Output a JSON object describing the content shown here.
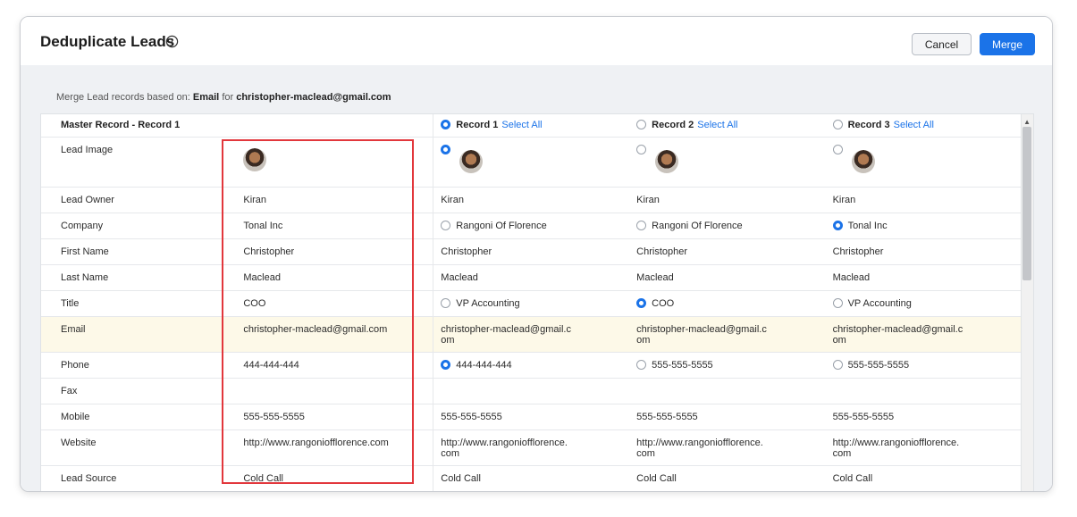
{
  "header": {
    "title": "Deduplicate Leads",
    "cancel_label": "Cancel",
    "merge_label": "Merge"
  },
  "merge_info": {
    "prefix": "Merge Lead records based on:",
    "field": "Email",
    "mid": "for",
    "value": "christopher-maclead@gmail.com"
  },
  "columns": {
    "master": "Master Record - Record 1",
    "records": [
      {
        "label": "Record 1",
        "select_all": "Select All",
        "selected": true
      },
      {
        "label": "Record 2",
        "select_all": "Select All",
        "selected": false
      },
      {
        "label": "Record 3",
        "select_all": "Select All",
        "selected": false
      }
    ]
  },
  "rows": [
    {
      "field": "Lead Image",
      "master": "",
      "values": [
        "",
        "",
        ""
      ],
      "radios": [
        true,
        false,
        false
      ],
      "image": true
    },
    {
      "field": "Lead Owner",
      "master": "Kiran",
      "values": [
        "Kiran",
        "Kiran",
        "Kiran"
      ]
    },
    {
      "field": "Company",
      "master": "Tonal Inc",
      "values": [
        "Rangoni Of Florence",
        "Rangoni Of Florence",
        "Tonal Inc"
      ],
      "radios": [
        false,
        false,
        true
      ]
    },
    {
      "field": "First Name",
      "master": "Christopher",
      "values": [
        "Christopher",
        "Christopher",
        "Christopher"
      ]
    },
    {
      "field": "Last Name",
      "master": "Maclead",
      "values": [
        "Maclead",
        "Maclead",
        "Maclead"
      ]
    },
    {
      "field": "Title",
      "master": "COO",
      "values": [
        "VP Accounting",
        "COO",
        "VP Accounting"
      ],
      "radios": [
        false,
        true,
        false
      ]
    },
    {
      "field": "Email",
      "master": "christopher-maclead@gmail.com",
      "values": [
        "christopher-maclead@gmail.c om",
        "christopher-maclead@gmail.c om",
        "christopher-maclead@gmail.c om"
      ],
      "highlight": true,
      "tall": true
    },
    {
      "field": "Phone",
      "master": "444-444-444",
      "values": [
        "444-444-444",
        "555-555-5555",
        "555-555-5555"
      ],
      "radios": [
        true,
        false,
        false
      ]
    },
    {
      "field": "Fax",
      "master": "",
      "values": [
        "",
        "",
        ""
      ]
    },
    {
      "field": "Mobile",
      "master": "555-555-5555",
      "values": [
        "555-555-5555",
        "555-555-5555",
        "555-555-5555"
      ]
    },
    {
      "field": "Website",
      "master": "http://www.rangoniofflorence.com",
      "values": [
        "http://www.rangoniofflorence. com",
        "http://www.rangoniofflorence. com",
        "http://www.rangoniofflorence. com"
      ],
      "tall": true
    },
    {
      "field": "Lead Source",
      "master": "Cold Call",
      "values": [
        "Cold Call",
        "Cold Call",
        "Cold Call"
      ]
    }
  ],
  "colors": {
    "accent": "#1b73e8",
    "highlight_row": "#fdf9e8",
    "annotation_box": "#e2373c"
  }
}
